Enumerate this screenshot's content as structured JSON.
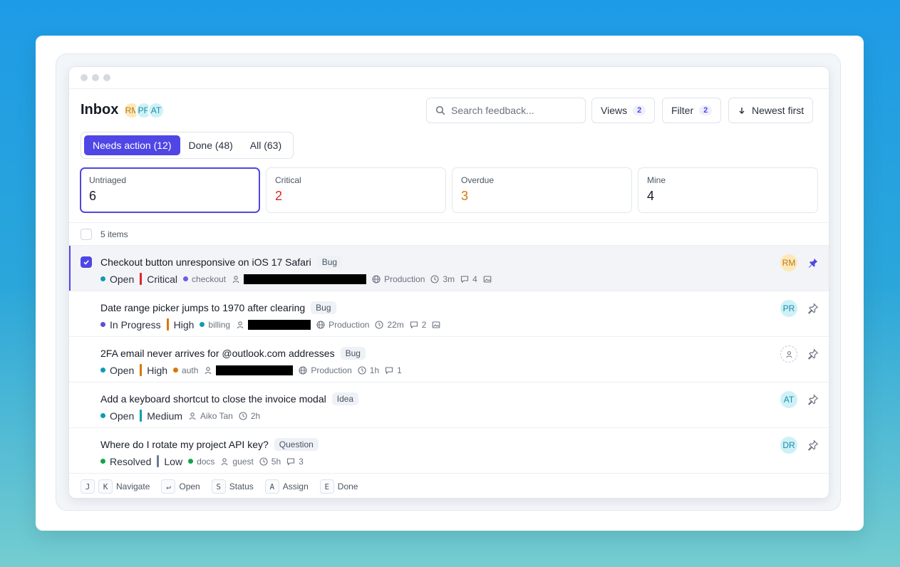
{
  "header": {
    "title": "Inbox",
    "avatars": [
      "RM",
      "PR",
      "AT"
    ],
    "search_placeholder": "Search feedback...",
    "views_label": "Views",
    "views_count": "2",
    "filter_label": "Filter",
    "filter_count": "2",
    "sort_label": "Newest first"
  },
  "tabs": [
    {
      "label": "Needs action (12)",
      "active": true
    },
    {
      "label": "Done (48)",
      "active": false
    },
    {
      "label": "All (63)",
      "active": false
    }
  ],
  "stats": [
    {
      "label": "Untriaged",
      "value": "6"
    },
    {
      "label": "Critical",
      "value": "2"
    },
    {
      "label": "Overdue",
      "value": "3"
    },
    {
      "label": "Mine",
      "value": "4"
    }
  ],
  "list": {
    "count_label": "5 items",
    "rows": [
      {
        "title": "Checkout button unresponsive on iOS 17 Safari",
        "tag": "Bug",
        "status": "Open",
        "priority": "Critical",
        "area": "checkout",
        "env": "Production",
        "age": "3m",
        "comments": "4",
        "assignee_initials": "RM"
      },
      {
        "title": "Date range picker jumps to 1970 after clearing",
        "tag": "Bug",
        "status": "In Progress",
        "priority": "High",
        "area": "billing",
        "env": "Production",
        "age": "22m",
        "comments": "2",
        "assignee_initials": "PR"
      },
      {
        "title": "2FA email never arrives for @outlook.com addresses",
        "tag": "Bug",
        "status": "Open",
        "priority": "High",
        "area": "auth",
        "env": "Production",
        "age": "1h",
        "comments": "1",
        "assignee_initials": ""
      },
      {
        "title": "Add a keyboard shortcut to close the invoice modal",
        "tag": "Idea",
        "status": "Open",
        "priority": "Medium",
        "reporter": "Aiko Tan",
        "age": "2h",
        "assignee_initials": "AT"
      },
      {
        "title": "Where do I rotate my project API key?",
        "tag": "Question",
        "status": "Resolved",
        "priority": "Low",
        "area": "docs",
        "reporter": "guest",
        "age": "5h",
        "comments": "3",
        "assignee_initials": "DR"
      }
    ]
  },
  "shortcuts": [
    {
      "keys": [
        "J",
        "K"
      ],
      "label": "Navigate"
    },
    {
      "keys": [
        "↵"
      ],
      "label": "Open"
    },
    {
      "keys": [
        "S"
      ],
      "label": "Status"
    },
    {
      "keys": [
        "A"
      ],
      "label": "Assign"
    },
    {
      "keys": [
        "E"
      ],
      "label": "Done"
    }
  ],
  "colors": {
    "accent": "#4f46e5",
    "open": "#0e9bb5",
    "in_progress": "#5b4fd8",
    "resolved": "#16a34a",
    "critical": "#dc2626",
    "high": "#d97706",
    "medium": "#0e9bb5",
    "low": "#6b7a99"
  },
  "icons": {
    "search": "search-icon",
    "sort": "arrow-down-icon",
    "user": "user-icon",
    "globe": "globe-icon",
    "clock": "clock-icon",
    "comment": "comment-icon",
    "image": "image-icon",
    "pin": "pin-icon",
    "check": "check-icon"
  }
}
